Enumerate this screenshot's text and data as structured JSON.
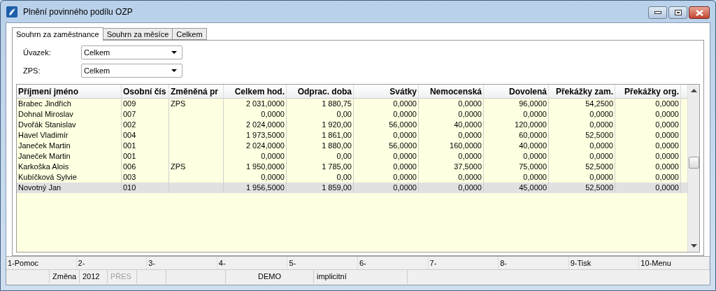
{
  "window": {
    "title": "Plnění povinného podílu OZP"
  },
  "tabs": [
    {
      "label": "Souhrn za zaměstnance",
      "selected": true
    },
    {
      "label": "Souhrn za měsíce",
      "selected": false
    },
    {
      "label": "Celkem",
      "selected": false
    }
  ],
  "filters": [
    {
      "label": "Úvazek:",
      "value": "Celkem"
    },
    {
      "label": "ZPS:",
      "value": "Celkem"
    }
  ],
  "table": {
    "columns": [
      "Příjmení jméno",
      "Osobní čís",
      "Změněná pr",
      "Celkem hod.",
      "Odprac. doba",
      "Svátky",
      "Nemocenská",
      "Dovolená",
      "Překážky zam.",
      "Překážky org."
    ],
    "rows": [
      {
        "selected": false,
        "cells": [
          "Brabec Jindřich",
          "009",
          "ZPS",
          "2 031,0000",
          "1 880,75",
          "0,0000",
          "0,0000",
          "96,0000",
          "54,2500",
          "0,0000"
        ]
      },
      {
        "selected": false,
        "cells": [
          "Dohnal Miroslav",
          "007",
          "",
          "0,0000",
          "0,00",
          "0,0000",
          "0,0000",
          "0,0000",
          "0,0000",
          "0,0000"
        ]
      },
      {
        "selected": false,
        "cells": [
          "Dvořák Stanislav",
          "002",
          "",
          "2 024,0000",
          "1 920,00",
          "56,0000",
          "40,0000",
          "120,0000",
          "0,0000",
          "0,0000"
        ]
      },
      {
        "selected": false,
        "cells": [
          "Havel Vladimír",
          "004",
          "",
          "1 973,5000",
          "1 861,00",
          "0,0000",
          "0,0000",
          "60,0000",
          "52,5000",
          "0,0000"
        ]
      },
      {
        "selected": false,
        "cells": [
          "Janeček Martin",
          "001",
          "",
          "2 024,0000",
          "1 880,00",
          "56,0000",
          "160,0000",
          "40,0000",
          "0,0000",
          "0,0000"
        ]
      },
      {
        "selected": false,
        "cells": [
          "Janeček Martin",
          "001",
          "",
          "0,0000",
          "0,00",
          "0,0000",
          "0,0000",
          "0,0000",
          "0,0000",
          "0,0000"
        ]
      },
      {
        "selected": false,
        "cells": [
          "Karkoška Alois",
          "006",
          "ZPS",
          "1 950,0000",
          "1 785,00",
          "0,0000",
          "37,5000",
          "75,0000",
          "52,5000",
          "0,0000"
        ]
      },
      {
        "selected": false,
        "cells": [
          "Kubíčková Sylvie",
          "003",
          "",
          "0,0000",
          "0,00",
          "0,0000",
          "0,0000",
          "0,0000",
          "0,0000",
          "0,0000"
        ]
      },
      {
        "selected": true,
        "cells": [
          "Novotný Jan",
          "010",
          "",
          "1 956,5000",
          "1 859,00",
          "0,0000",
          "0,0000",
          "45,0000",
          "52,5000",
          "0,0000"
        ]
      }
    ]
  },
  "function_keys": [
    "1-Pomoc",
    "2-",
    "3-",
    "4-",
    "5-",
    "6-",
    "7-",
    "8-",
    "9-Tisk",
    "10-Menu"
  ],
  "status_bar": [
    {
      "text": "Změna",
      "disabled": false
    },
    {
      "text": "2012",
      "disabled": false
    },
    {
      "text": "PŘES",
      "disabled": true
    },
    {
      "text": "DEMO",
      "disabled": false
    },
    {
      "text": "implicitní",
      "disabled": false
    }
  ]
}
